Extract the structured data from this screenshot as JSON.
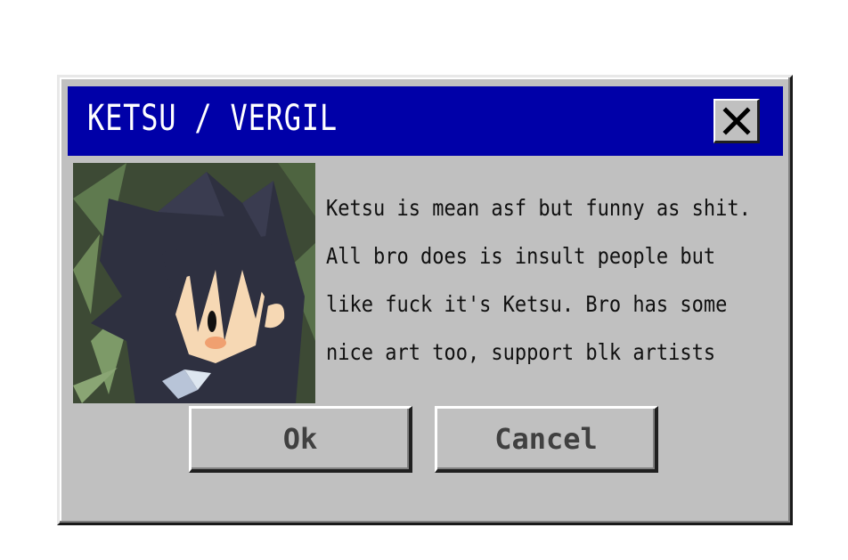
{
  "dialog": {
    "title": "KETSU / VERGIL",
    "close_icon": "close-x-icon",
    "message_lines": [
      "Ketsu is mean asf but funny as shit.",
      "All bro does is insult people but",
      "like fuck it's Ketsu. Bro has some",
      "nice art too, support blk artists"
    ],
    "ok_label": "Ok",
    "cancel_label": "Cancel"
  },
  "colors": {
    "titlebar": "#0000a8",
    "dialog_face": "#c0c0c0",
    "title_text": "#ffffff"
  }
}
